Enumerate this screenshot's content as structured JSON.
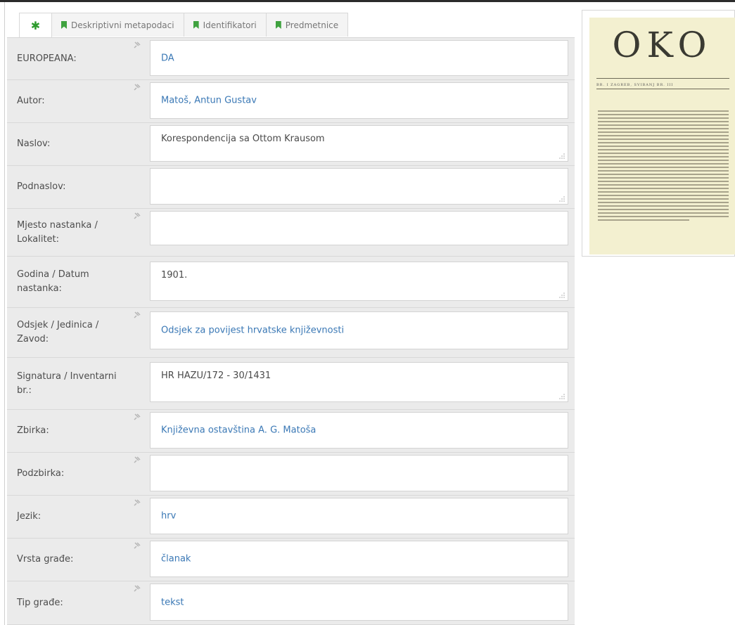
{
  "tabs": [
    {
      "label": "✱",
      "active": true
    },
    {
      "label": "Deskriptivni metapodaci"
    },
    {
      "label": "Identifikatori"
    },
    {
      "label": "Predmetnice"
    }
  ],
  "fields": [
    {
      "label": "EUROPEANA:",
      "value": "DA"
    },
    {
      "label": "Autor:",
      "value": "Matoš, Antun Gustav"
    },
    {
      "label": "Naslov:",
      "value": "Korespondencija sa Ottom Krausom"
    },
    {
      "label": "Podnaslov:",
      "value": ""
    },
    {
      "label": "Mjesto nastanka / Lokalitet:",
      "value": ""
    },
    {
      "label": "Godina / Datum nastanka:",
      "value": "1901."
    },
    {
      "label": "Odsjek / Jedinica / Zavod:",
      "value": "Odsjek za povijest hrvatske književnosti"
    },
    {
      "label": "Signatura / Inventarni br.:",
      "value": "HR HAZU/172 - 30/1431"
    },
    {
      "label": "Zbirka:",
      "value": "Književna ostavština A. G. Matoša"
    },
    {
      "label": "Podzbirka:",
      "value": ""
    },
    {
      "label": "Jezik:",
      "value": "hrv"
    },
    {
      "label": "Vrsta građe:",
      "value": "članak"
    },
    {
      "label": "Tip građe:",
      "value": "tekst"
    }
  ],
  "thumbnail": {
    "masthead": "OKO",
    "subline": "BR. I   ZAGREB, SVIBANJ   BR. III"
  }
}
